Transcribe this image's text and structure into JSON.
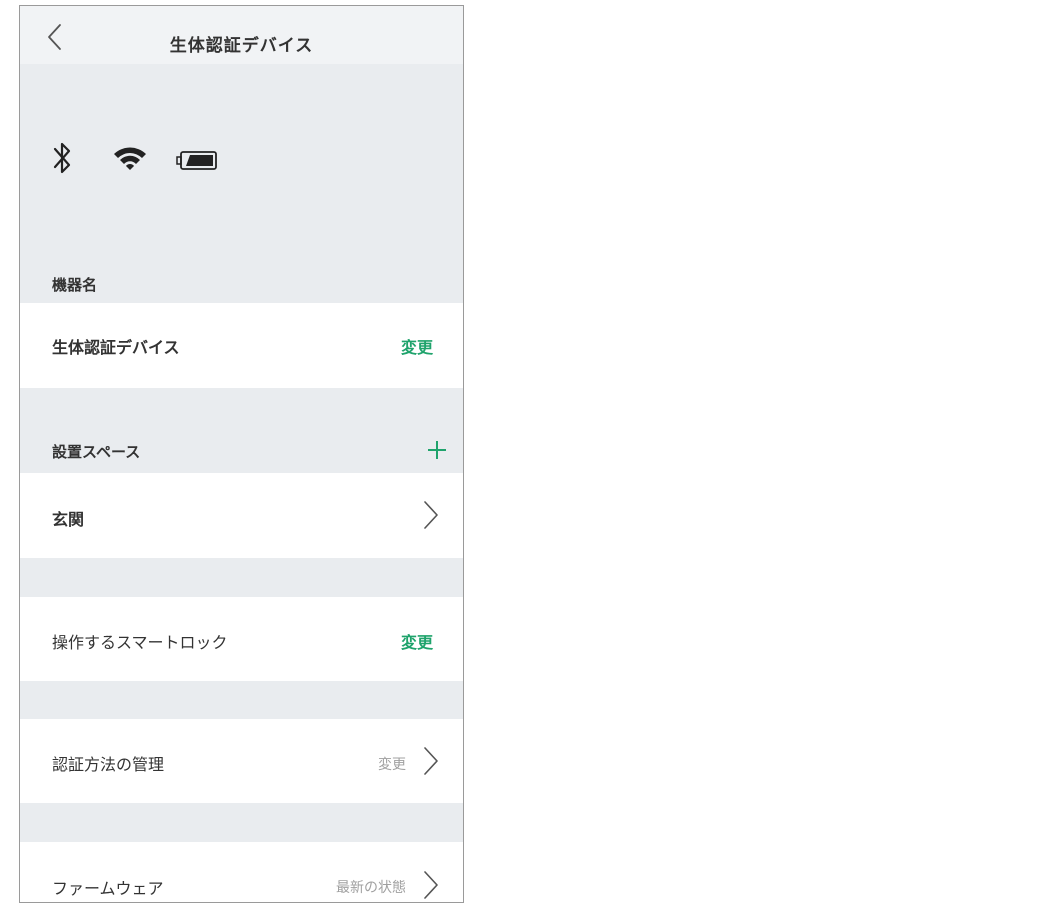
{
  "header": {
    "title": "生体認証デバイス"
  },
  "device_name": {
    "section_label": "機器名",
    "value": "生体認証デバイス",
    "action": "変更"
  },
  "install_space": {
    "section_label": "設置スペース",
    "value": "玄関"
  },
  "smart_lock": {
    "label": "操作するスマートロック",
    "action": "変更"
  },
  "auth_methods": {
    "label": "認証方法の管理",
    "value": "変更"
  },
  "firmware": {
    "label": "ファームウェア",
    "value": "最新の状態"
  },
  "colors": {
    "accent_green": "#1fa36c",
    "background_gray": "#e9ecef"
  }
}
